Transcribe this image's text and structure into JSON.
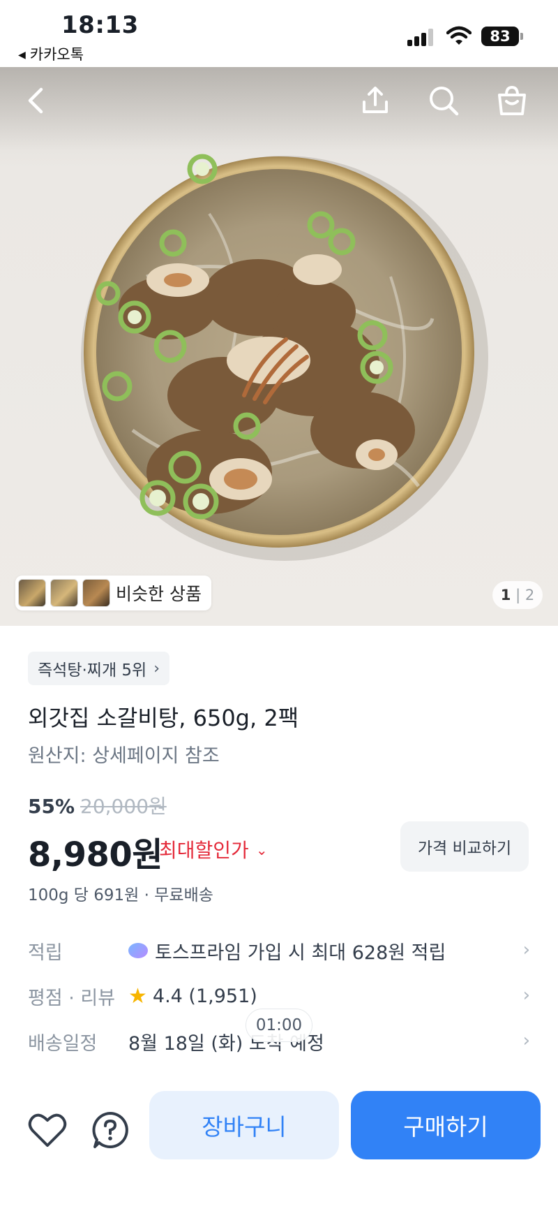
{
  "status_bar": {
    "time": "18:13",
    "back_app": "카카오톡",
    "battery": "83"
  },
  "hero": {
    "similar_label": "비슷한 상품",
    "pager_current": "1",
    "pager_separator": "|",
    "pager_total": "2",
    "icons": [
      "back-icon",
      "share-icon",
      "search-icon",
      "shopping-bag-icon"
    ]
  },
  "product": {
    "rank_label": "즉석탕·찌개 5위",
    "title": "외갓집 소갈비탕, 650g, 2팩",
    "origin": "원산지: 상세페이지 참조",
    "discount_pct": "55%",
    "original_price": "20,000원",
    "price": "8,980원",
    "max_discount_label": "최대할인가",
    "compare_label": "가격 비교하기",
    "unit_price": "100g 당 691원 · 무료배송"
  },
  "info_rows": [
    {
      "label": "적립",
      "value": "토스프라임 가입 시 최대 628원 적립"
    },
    {
      "label": "평점 · 리뷰",
      "value": "4.4 (1,951)"
    },
    {
      "label": "배송일정",
      "value": "8월 18일 (화) 도착 예정"
    }
  ],
  "overlay": {
    "timer": "01:00"
  },
  "bottom_bar": {
    "cart_label": "장바구니",
    "buy_label": "구매하기"
  },
  "colors": {
    "accent_blue": "#3182f6",
    "discount_red": "#e42939",
    "star_yellow": "#f7b500"
  }
}
